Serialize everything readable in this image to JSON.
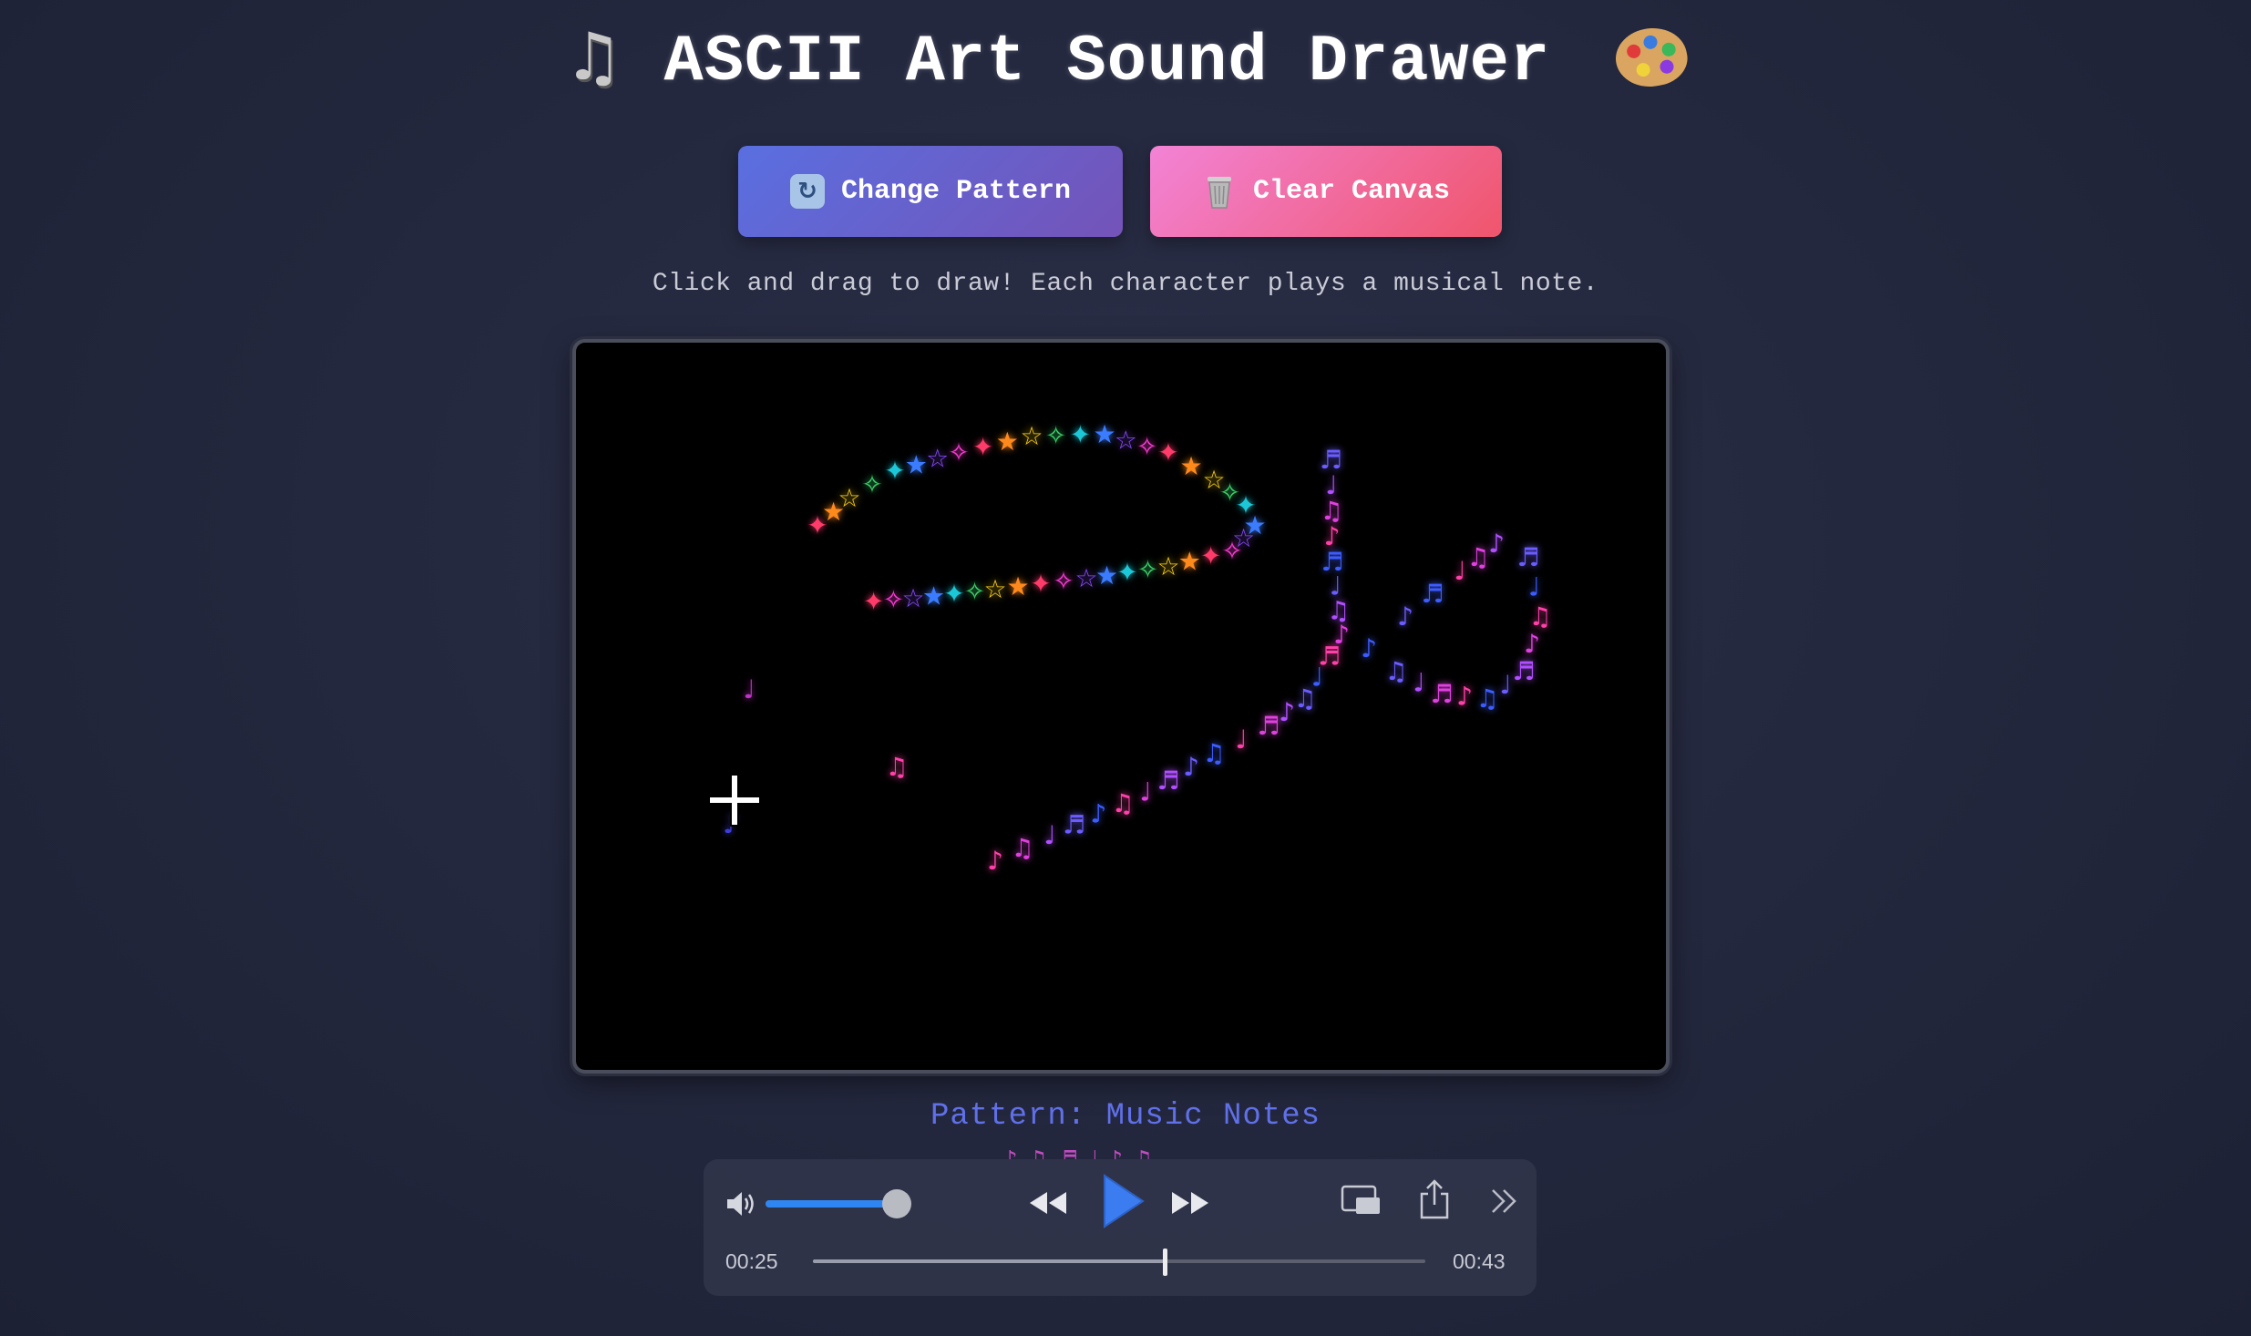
{
  "header": {
    "title": "ASCII Art Sound Drawer",
    "left_icon": "musical-notes-emoji",
    "right_icon": "artist-palette-emoji"
  },
  "toolbar": {
    "change_label": "Change Pattern",
    "change_icon": "refresh-icon",
    "clear_label": "Clear Canvas",
    "clear_icon": "trash-icon"
  },
  "instructions": "Click and drag to draw! Each character plays a musical note.",
  "canvas": {
    "star_chars": [
      "✦",
      "★",
      "☆",
      "✧"
    ],
    "note_chars": [
      "♪",
      "♫",
      "♩",
      "♬"
    ],
    "star_colors": [
      "#ff3b6b",
      "#ff8a1e",
      "#ffd21e",
      "#3bd16b",
      "#1ec8d8",
      "#3b7bff",
      "#8a4bff",
      "#ff3bd8"
    ],
    "note_colors": [
      "#ff3fa8",
      "#e040e0",
      "#b050ff",
      "#6a5bff",
      "#3c5cff"
    ]
  },
  "pattern_label": "Pattern: Music Notes",
  "pattern_preview": "♪♫♬♩♪♫",
  "player": {
    "current_time": "00:25",
    "total_time": "00:43",
    "progress": 0.575,
    "volume": 0.9,
    "icons": [
      "volume-icon",
      "rewind-icon",
      "play-icon",
      "fast-forward-icon",
      "picture-in-picture-icon",
      "share-icon",
      "more-icon"
    ]
  }
}
